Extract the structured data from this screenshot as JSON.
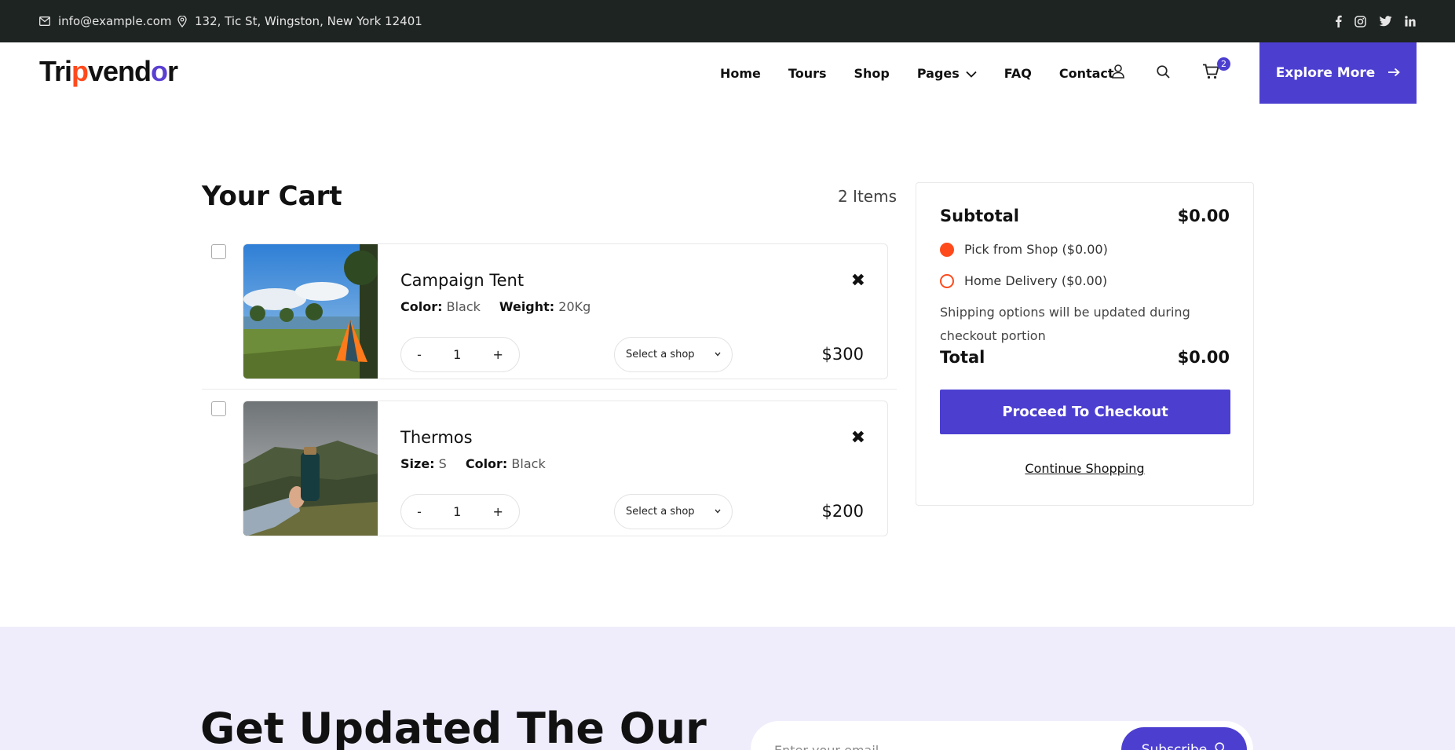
{
  "topbar": {
    "email": "info@example.com",
    "address": "132, Tic St, Wingston, New York 12401",
    "social_icons": [
      "facebook-icon",
      "instagram-icon",
      "twitter-icon",
      "linkedin-icon"
    ]
  },
  "header": {
    "logo_parts": [
      "Tri",
      "p",
      "vend",
      "o",
      "r"
    ],
    "nav": [
      "Home",
      "Tours",
      "Shop",
      "Pages",
      "FAQ",
      "Contact"
    ],
    "cart_badge": "2",
    "explore_label": "Explore More"
  },
  "cart": {
    "title": "Your Cart",
    "count": "2 Items",
    "items": [
      {
        "name": "Campaign Tent",
        "attr1_label": "Color:",
        "attr1_value": "Black",
        "attr2_label": "Weight:",
        "attr2_value": "20Kg",
        "qty": "1",
        "minus": "-",
        "plus": "+",
        "shop_select": "Select a shop",
        "price": "$300",
        "remove": "✖"
      },
      {
        "name": "Thermos",
        "attr1_label": "Size:",
        "attr1_value": "S",
        "attr2_label": "Color:",
        "attr2_value": "Black",
        "qty": "1",
        "minus": "-",
        "plus": "+",
        "shop_select": "Select a shop",
        "price": "$200",
        "remove": "✖"
      }
    ]
  },
  "summary": {
    "subtotal_label": "Subtotal",
    "subtotal_value": "$0.00",
    "option_pick": "Pick from Shop ($0.00)",
    "option_delivery": "Home Delivery ($0.00)",
    "shipping_note": "Shipping options will be updated during checkout portion",
    "total_label": "Total",
    "total_value": "$0.00",
    "checkout_label": "Proceed To Checkout",
    "continue_label": "Continue Shopping"
  },
  "newsletter": {
    "title": "Get Updated The Our",
    "placeholder": "Enter your email",
    "button": "Subscribe"
  },
  "colors": {
    "accent": "#4c3fd0",
    "orange": "#ff4a1c",
    "topbar_bg": "#1e2421",
    "newsletter_bg": "#efedfb"
  }
}
